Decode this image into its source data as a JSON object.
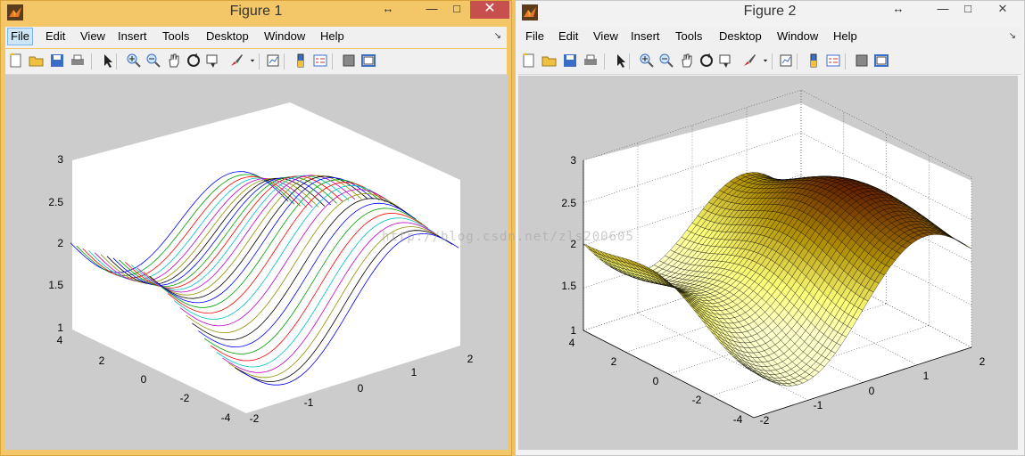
{
  "figure1": {
    "title": "Figure 1",
    "menu": [
      "File",
      "Edit",
      "View",
      "Insert",
      "Tools",
      "Desktop",
      "Window",
      "Help"
    ],
    "selected_menu": "File",
    "window_controls": {
      "restore": "↔",
      "minimize": "—",
      "maximize": "□",
      "close": "✕"
    },
    "plot": {
      "style": "mesh-colored-lines",
      "grid": false
    }
  },
  "figure2": {
    "title": "Figure 2",
    "menu": [
      "File",
      "Edit",
      "View",
      "Insert",
      "Tools",
      "Desktop",
      "Window",
      "Help"
    ],
    "window_controls": {
      "restore": "↔",
      "minimize": "—",
      "maximize": "□",
      "close": "✕"
    },
    "plot": {
      "style": "surface-colormap",
      "grid": true
    }
  },
  "toolbar_icons": [
    "new-figure-icon",
    "open-file-icon",
    "save-icon",
    "print-icon",
    "pointer-icon",
    "zoom-in-icon",
    "zoom-out-icon",
    "pan-icon",
    "rotate-3d-icon",
    "data-cursor-icon",
    "brush-icon",
    "brush-dropdown-icon",
    "link-plot-icon",
    "colorbar-icon",
    "legend-icon",
    "hide-plot-tools-icon",
    "show-plot-tools-icon"
  ],
  "axes": {
    "z_ticks": [
      "1",
      "1.5",
      "2",
      "2.5",
      "3"
    ],
    "y_ticks": [
      "-4",
      "-2",
      "0",
      "2",
      "4"
    ],
    "x_ticks": [
      "-2",
      "-1",
      "0",
      "1",
      "2"
    ]
  },
  "watermark": "http://blog.csdn.net/zls200605",
  "colors": {
    "window_active": "#f3c768",
    "close": "#c7504e",
    "canvas": "#cccccc"
  }
}
